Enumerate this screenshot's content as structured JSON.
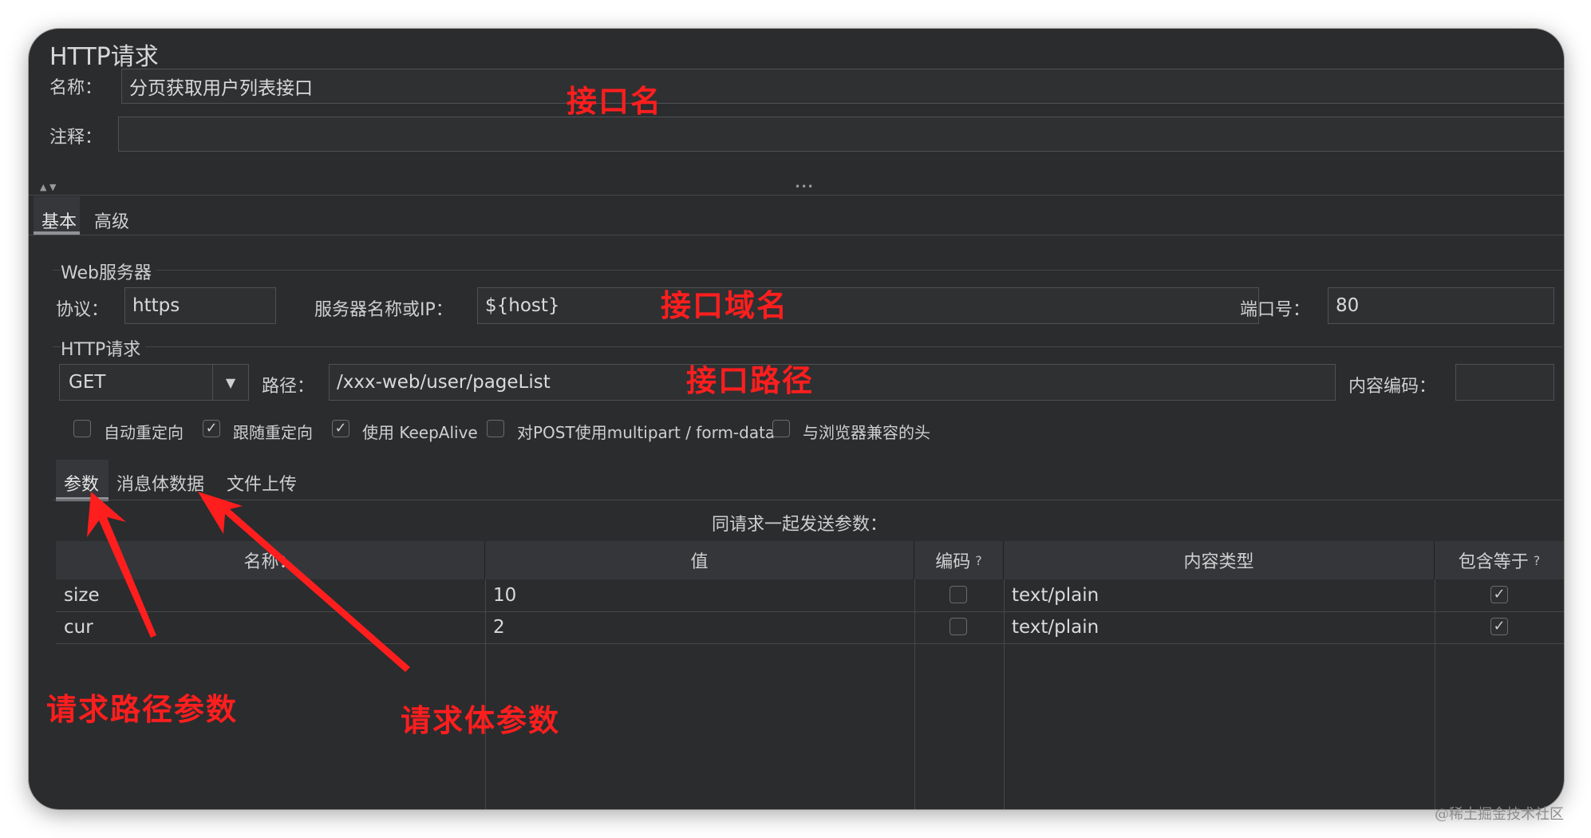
{
  "panel": {
    "title": "HTTP请求",
    "name_label": "名称：",
    "name_value": "分页获取用户列表接口",
    "comment_label": "注释：",
    "comment_value": ""
  },
  "splitter": {
    "dots": "•••"
  },
  "top_tabs": [
    "基本",
    "高级"
  ],
  "web_server": {
    "legend": "Web服务器",
    "protocol_label": "协议：",
    "protocol_value": "https",
    "server_label": "服务器名称或IP：",
    "server_value": "${host}",
    "port_label": "端口号：",
    "port_value": "80"
  },
  "http_request": {
    "legend": "HTTP请求",
    "method": "GET",
    "path_label": "路径：",
    "path_value": "/xxx-web/user/pageList",
    "encoding_label": "内容编码：",
    "encoding_value": ""
  },
  "options": [
    {
      "label": "自动重定向",
      "checked": false
    },
    {
      "label": "跟随重定向",
      "checked": true
    },
    {
      "label": "使用 KeepAlive",
      "checked": true
    },
    {
      "label": "对POST使用multipart / form-data",
      "checked": false
    },
    {
      "label": "与浏览器兼容的头",
      "checked": false
    }
  ],
  "sub_tabs": [
    "参数",
    "消息体数据",
    "文件上传"
  ],
  "params": {
    "caption": "同请求一起发送参数：",
    "columns": [
      "名称：",
      "值",
      "编码",
      "内容类型",
      "包含等于"
    ],
    "help_mark": "?",
    "rows": [
      {
        "name": "size",
        "value": "10",
        "encode": false,
        "content_type": "text/plain",
        "include_equals": true
      },
      {
        "name": "cur",
        "value": "2",
        "encode": false,
        "content_type": "text/plain",
        "include_equals": true
      }
    ]
  },
  "annotations": {
    "interface_name": "接口名",
    "interface_domain": "接口域名",
    "interface_path": "接口路径",
    "path_params": "请求路径参数",
    "body_params": "请求体参数"
  },
  "watermark": "@稀土掘金技术社区",
  "colors": {
    "annotation": "#ff1e1e",
    "panel_bg": "#2b2c2e"
  }
}
